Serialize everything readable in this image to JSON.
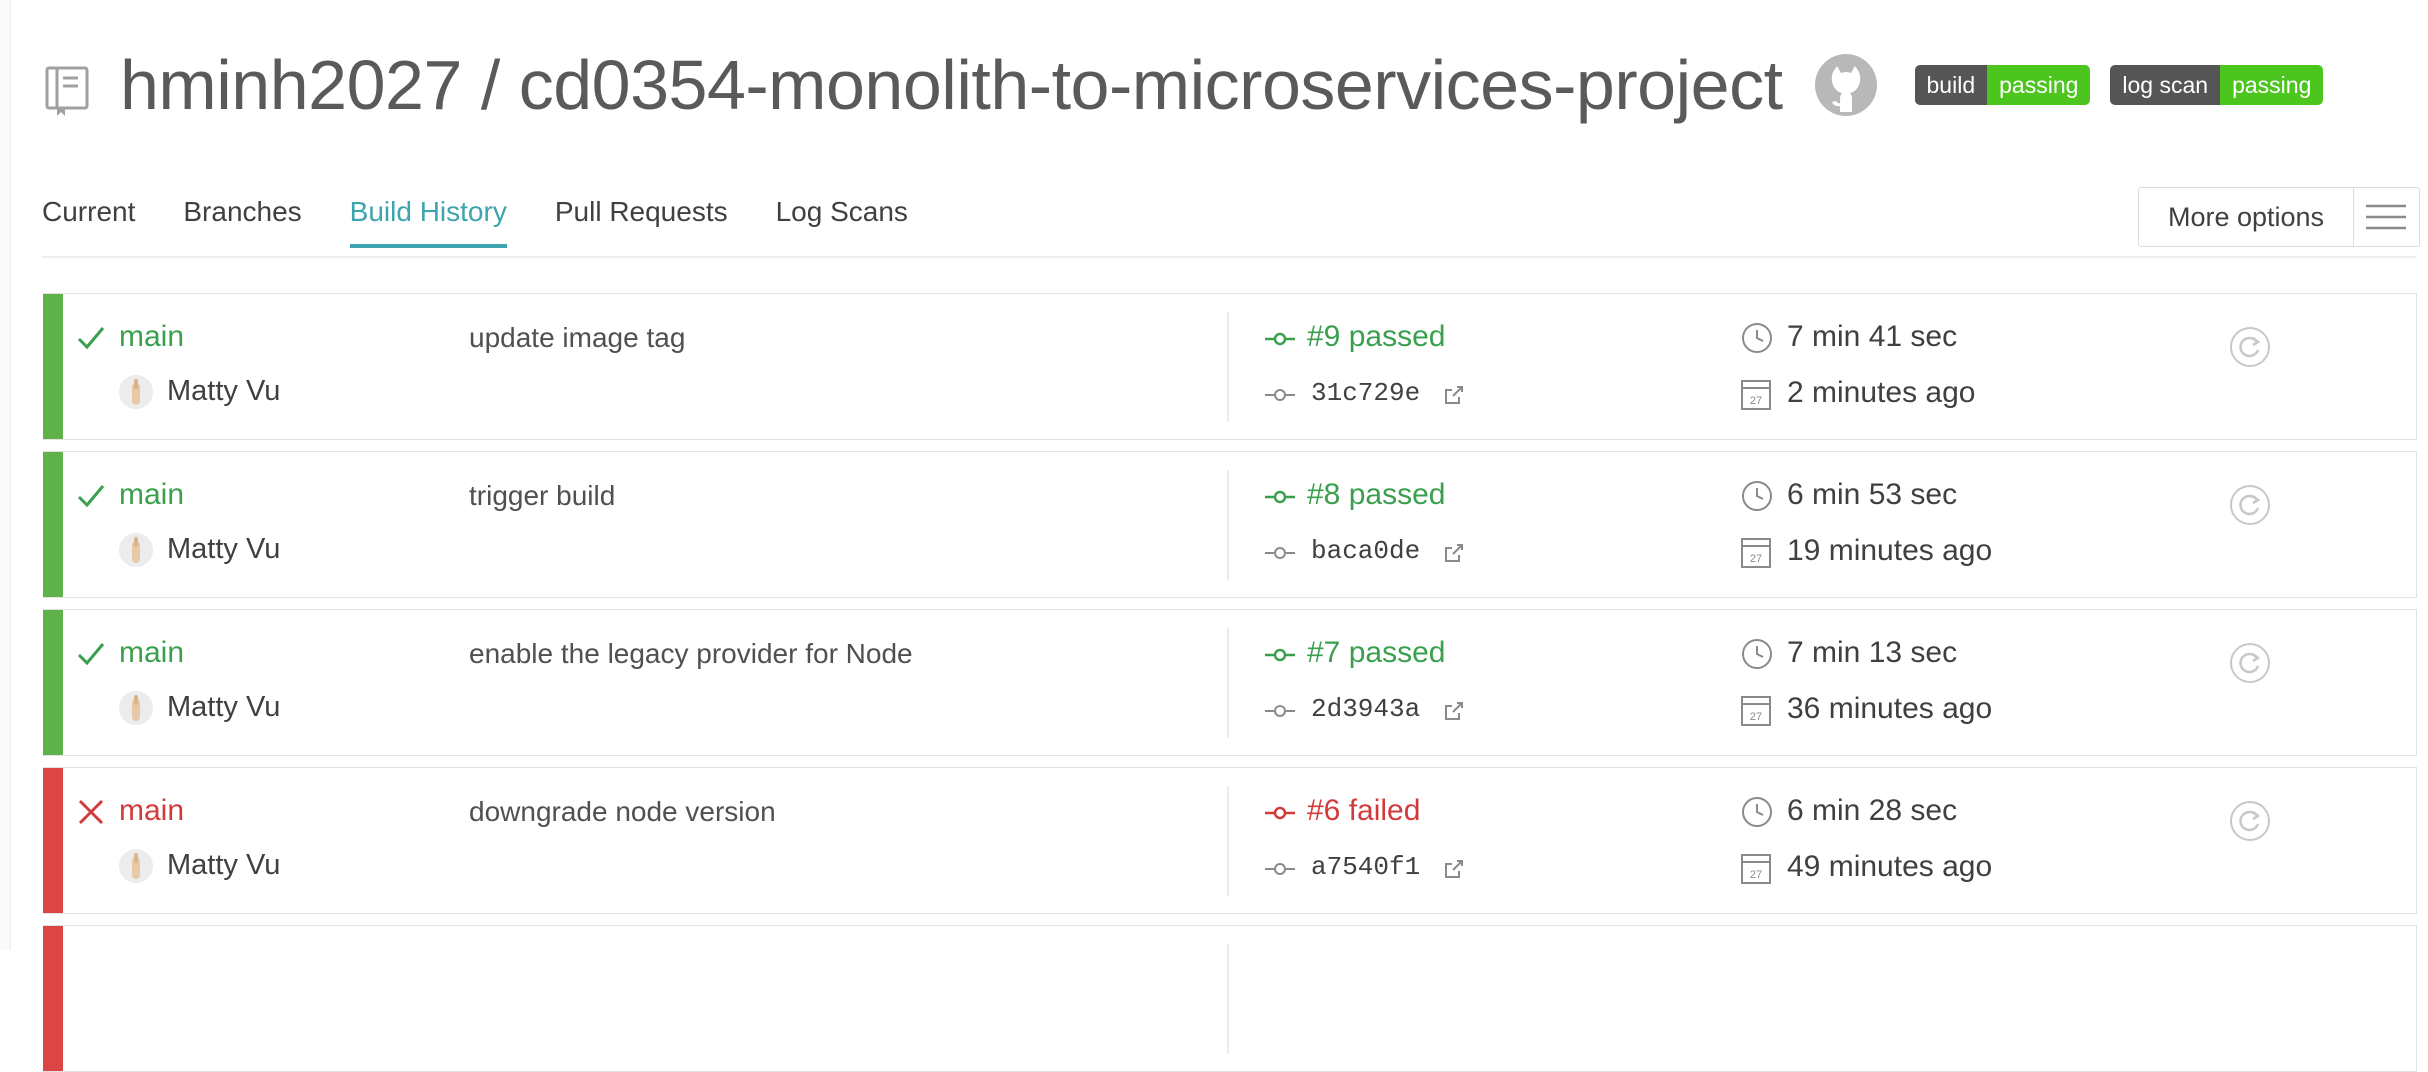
{
  "header": {
    "repo_title": "hminh2027 / cd0354-monolith-to-microservices-project",
    "repo_icon": "repo-book-icon",
    "github_icon": "github-octocat-icon",
    "badges": [
      {
        "key": "build",
        "value": "passing"
      },
      {
        "key": "log scan",
        "value": "passing"
      }
    ]
  },
  "tabs": [
    {
      "label": "Current"
    },
    {
      "label": "Branches"
    },
    {
      "label": "Build History",
      "active": true
    },
    {
      "label": "Pull Requests"
    },
    {
      "label": "Log Scans"
    }
  ],
  "more_options": {
    "label": "More options"
  },
  "builds": [
    {
      "state": "passed",
      "branch": "main",
      "author": "Matty Vu",
      "message": "update image tag",
      "number": "#9 passed",
      "sha": "31c729e",
      "duration": "7 min 41 sec",
      "finished": "2 minutes ago"
    },
    {
      "state": "passed",
      "branch": "main",
      "author": "Matty Vu",
      "message": "trigger build",
      "number": "#8 passed",
      "sha": "baca0de",
      "duration": "6 min 53 sec",
      "finished": "19 minutes ago"
    },
    {
      "state": "passed",
      "branch": "main",
      "author": "Matty Vu",
      "message": "enable the legacy provider for Node",
      "number": "#7 passed",
      "sha": "2d3943a",
      "duration": "7 min 13 sec",
      "finished": "36 minutes ago"
    },
    {
      "state": "failed",
      "branch": "main",
      "author": "Matty Vu",
      "message": "downgrade node version",
      "number": "#6 failed",
      "sha": "a7540f1",
      "duration": "6 min 28 sec",
      "finished": "49 minutes ago"
    },
    {
      "state": "failed"
    }
  ],
  "colors": {
    "passed": "#3aa04d",
    "failed": "#d23b3b",
    "accent": "#3ea4ad",
    "badge_key": "#555555",
    "badge_value": "#4cc61e"
  }
}
